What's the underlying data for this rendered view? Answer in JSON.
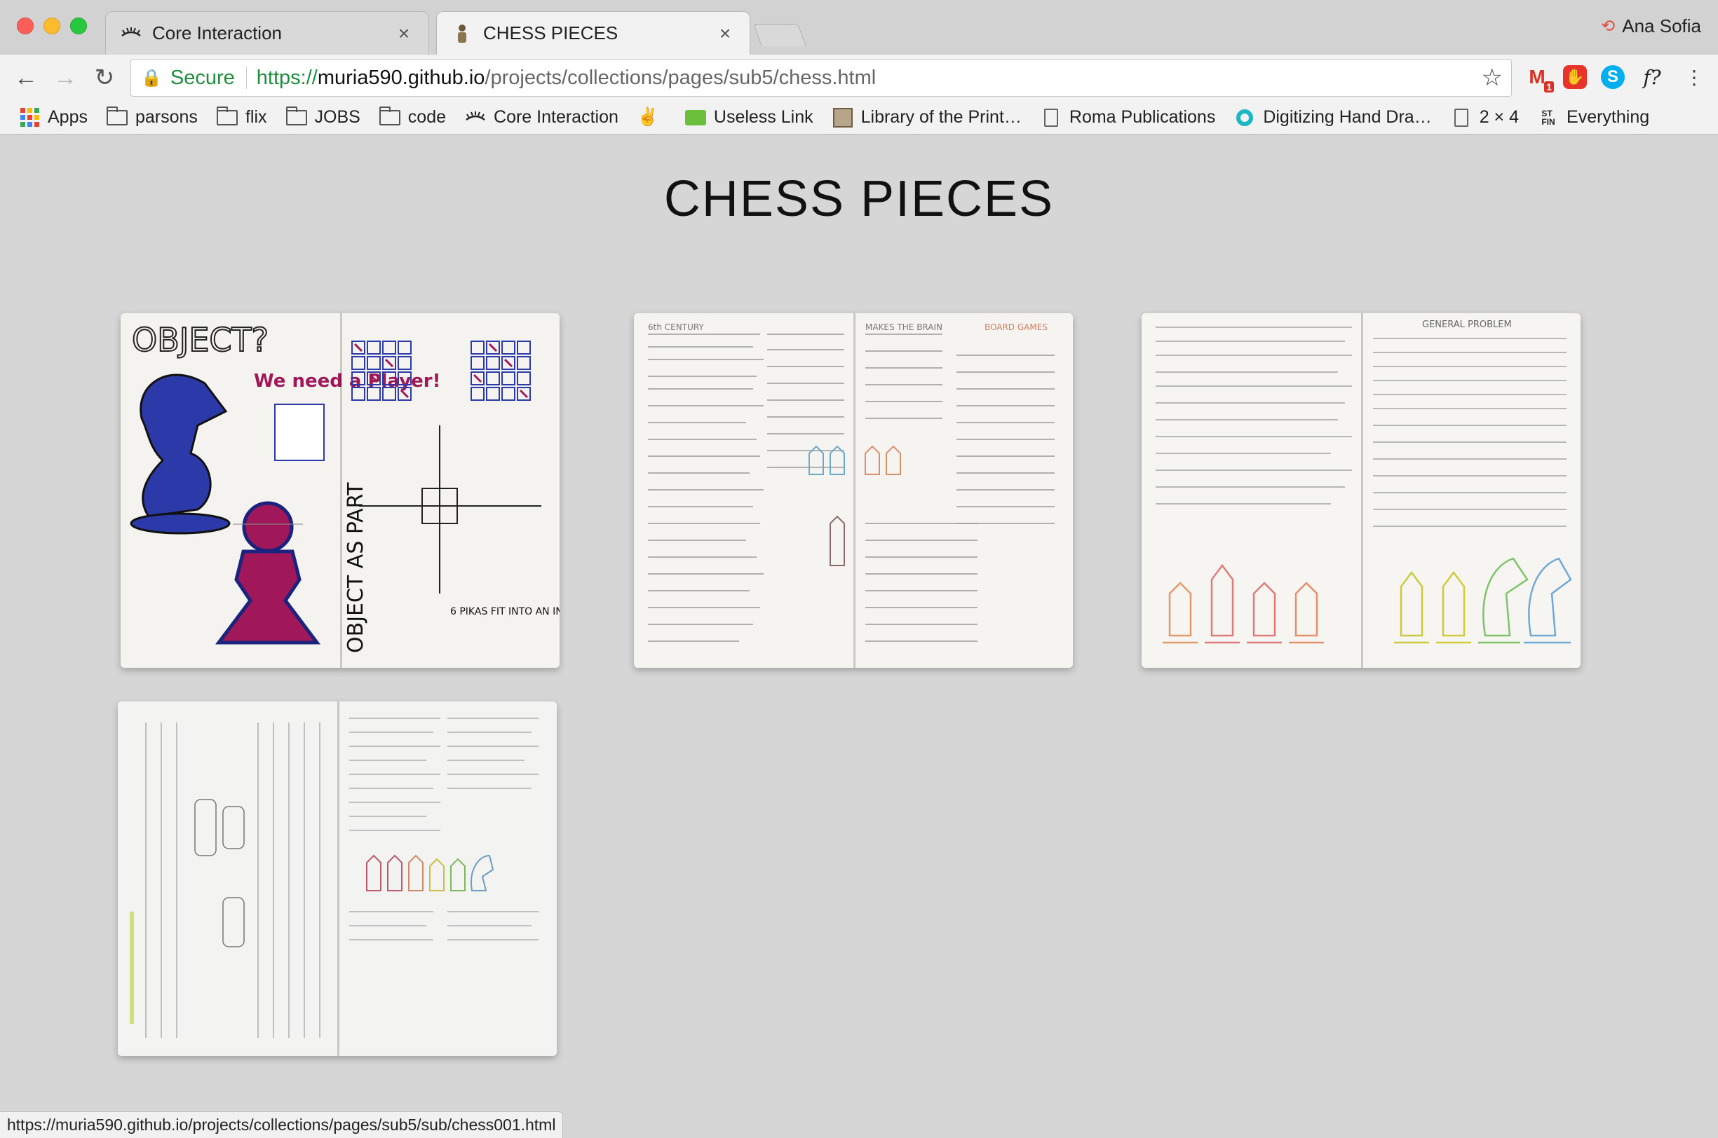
{
  "browser": {
    "tabs": [
      {
        "title": "Core Interaction",
        "favicon": "eyelash-icon",
        "active": false
      },
      {
        "title": "CHESS PIECES",
        "favicon": "figure-icon",
        "active": true
      }
    ],
    "profile_name": "Ana Sofia",
    "address": {
      "secure_label": "Secure",
      "scheme": "https://",
      "host": "muria590.github.io",
      "path": "/projects/collections/pages/sub5/chess.html"
    },
    "extensions": {
      "gmail_badge": "1",
      "fquery_label": "f?"
    },
    "bookmarks": [
      {
        "label": "Apps",
        "icon": "apps-grid-icon"
      },
      {
        "label": "parsons",
        "icon": "folder-icon"
      },
      {
        "label": "flix",
        "icon": "folder-icon"
      },
      {
        "label": "JOBS",
        "icon": "folder-icon"
      },
      {
        "label": "code",
        "icon": "folder-icon"
      },
      {
        "label": "Core Interaction",
        "icon": "eyelash-icon"
      },
      {
        "label": "",
        "icon": "peace-hand-icon"
      },
      {
        "label": "Useless Link",
        "icon": "green-badge-icon"
      },
      {
        "label": "Library of the Print…",
        "icon": "library-icon"
      },
      {
        "label": "Roma Publications",
        "icon": "document-icon"
      },
      {
        "label": "Digitizing Hand Dra…",
        "icon": "teal-circle-icon"
      },
      {
        "label": "2 × 4",
        "icon": "document-icon"
      },
      {
        "label": "Everything",
        "icon": "stk-fin-icon"
      }
    ]
  },
  "page": {
    "title": "CHESS PIECES",
    "thumbnails": [
      {
        "name": "chess-notebook-1",
        "alt": "Sketchbook spread: OBJECT? / We need a player!"
      },
      {
        "name": "chess-notebook-2",
        "alt": "Sketchbook spread: chess history timeline notes"
      },
      {
        "name": "chess-notebook-3",
        "alt": "Sketchbook spread: general problem, colored chess pieces"
      },
      {
        "name": "chess-notebook-4",
        "alt": "Sketchbook spread: pencil notes and chess pieces"
      }
    ]
  },
  "status_bar": {
    "url": "https://muria590.github.io/projects/collections/pages/sub5/sub/chess001.html"
  },
  "colors": {
    "secure_green": "#1e8e3e",
    "page_bg": "#d6d6d6",
    "sketch_blue": "#2b3aa8",
    "sketch_magenta": "#a0185a"
  }
}
